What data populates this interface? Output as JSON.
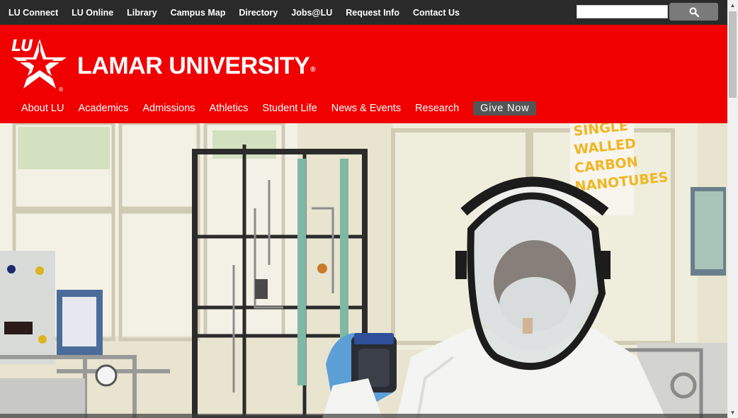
{
  "topbar": {
    "links": [
      "LU Connect",
      "LU Online",
      "Library",
      "Campus Map",
      "Directory",
      "Jobs@LU",
      "Request Info",
      "Contact Us"
    ],
    "search_placeholder": "",
    "search_icon": "search-icon"
  },
  "header": {
    "logo_letters": "LU",
    "wordmark": "LAMAR UNIVERSITY",
    "registered": "®",
    "nav": [
      "About LU",
      "Academics",
      "Admissions",
      "Athletics",
      "Student Life",
      "News & Events",
      "Research"
    ],
    "give_label": "Give Now"
  },
  "hero": {
    "poster_text": [
      "SINGLE",
      "WALLED",
      "CARBON",
      "NANOTUBES"
    ]
  },
  "colors": {
    "brand_red": "#f00000",
    "topbar_bg": "#2a2a2a",
    "give_bg": "#555555"
  }
}
